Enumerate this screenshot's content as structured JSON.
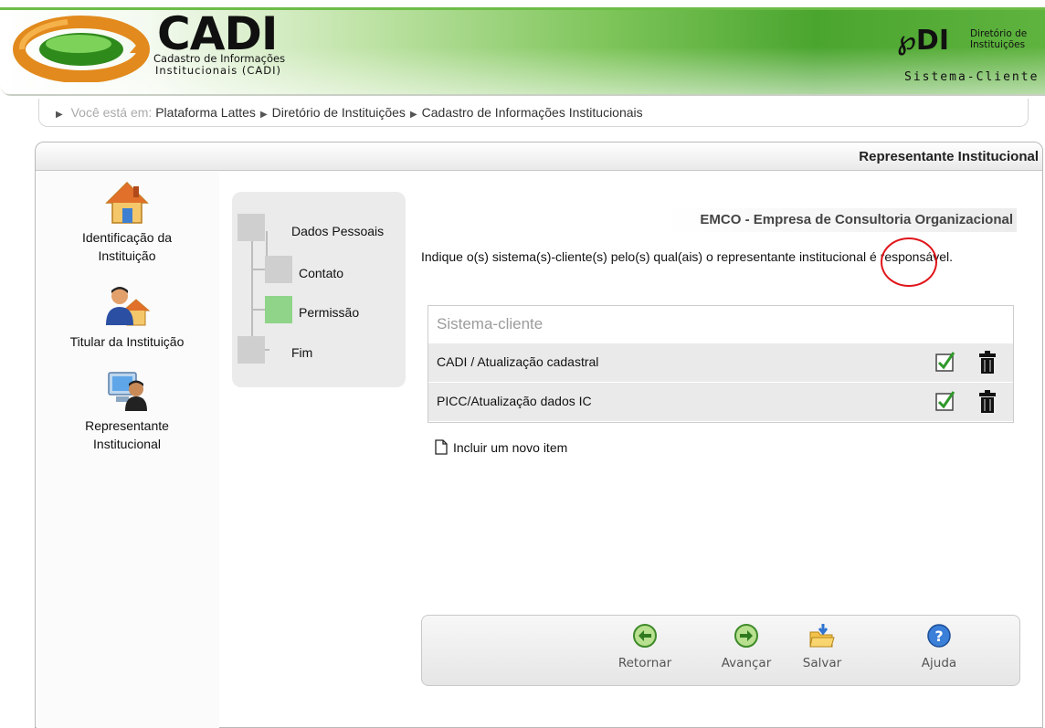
{
  "header": {
    "app_name": "CADI",
    "app_subtitle_line1": "Cadastro de Informações",
    "app_subtitle_line2": "Institucionais (CADI)",
    "partner_mark": "DI",
    "partner_line1": "Diretório de",
    "partner_line2": "Instituições",
    "client_label": "Sistema-Cliente"
  },
  "breadcrumb": {
    "prefix": "Você está em:",
    "items": [
      "Plataforma Lattes",
      "Diretório de Instituições",
      "Cadastro de Informações Institucionais"
    ]
  },
  "panel": {
    "title": "Representante Institucional"
  },
  "sidebar": {
    "items": [
      {
        "label": "Identificação da Instituição",
        "icon": "house-icon"
      },
      {
        "label": "Titular da Instituição",
        "icon": "person-house-icon"
      },
      {
        "label": "Representante Institucional",
        "icon": "person-computer-icon"
      }
    ]
  },
  "steps": {
    "items": [
      {
        "label": "Dados Pessoais",
        "active": false
      },
      {
        "label": "Contato",
        "active": false
      },
      {
        "label": "Permissão",
        "active": true
      },
      {
        "label": "Fim",
        "active": false
      }
    ]
  },
  "content": {
    "organization": "EMCO - Empresa de Consultoria Organizacional",
    "instruction": "Indique o(s) sistema(s)-cliente(s) pelo(s) qual(ais) o representante institucional é responsável.",
    "table": {
      "header": "Sistema-cliente",
      "rows": [
        {
          "label": "CADI / Atualização cadastral"
        },
        {
          "label": "PICC/Atualização dados IC"
        }
      ]
    },
    "add_item": "Incluir um novo item"
  },
  "toolbar": {
    "buttons": [
      {
        "label": "Retornar",
        "icon": "back-arrow-icon"
      },
      {
        "label": "Avançar",
        "icon": "forward-arrow-icon"
      },
      {
        "label": "Salvar",
        "icon": "save-folder-icon"
      },
      {
        "label": "Ajuda",
        "icon": "help-icon"
      }
    ]
  },
  "colors": {
    "brand_green": "#5fb33f",
    "active_step": "#8fd489",
    "highlight_circle": "#e0161b"
  }
}
